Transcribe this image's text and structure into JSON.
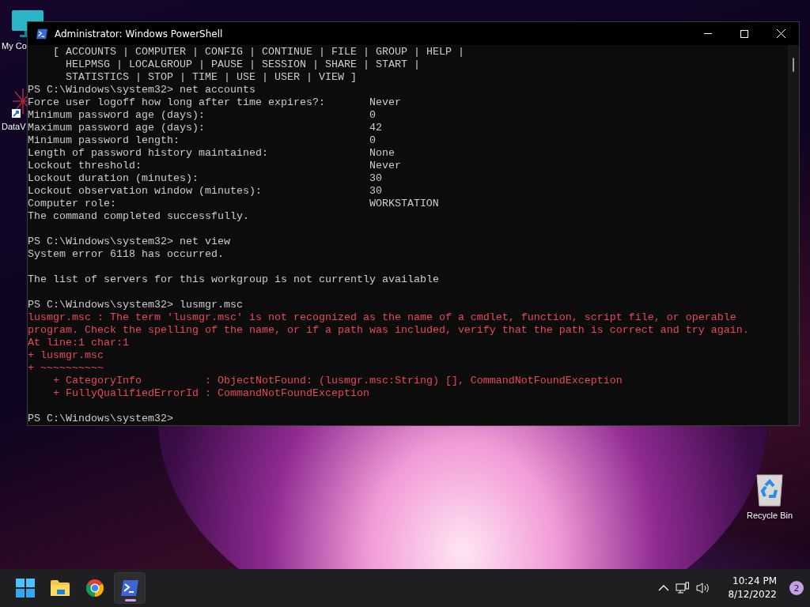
{
  "desktop_icons": [
    {
      "label": "My Co",
      "kind": "computer"
    },
    {
      "label": "DataV",
      "kind": "shortcut"
    },
    {
      "label": "Recycle Bin",
      "kind": "recycle"
    }
  ],
  "window": {
    "title": "Administrator: Windows PowerShell",
    "lines": [
      {
        "kind": "output",
        "text": "    [ ACCOUNTS | COMPUTER | CONFIG | CONTINUE | FILE | GROUP | HELP |"
      },
      {
        "kind": "output",
        "text": "      HELPMSG | LOCALGROUP | PAUSE | SESSION | SHARE | START |"
      },
      {
        "kind": "output",
        "text": "      STATISTICS | STOP | TIME | USE | USER | VIEW ]"
      },
      {
        "kind": "output",
        "text": "PS C:\\Windows\\system32> net accounts"
      },
      {
        "kind": "field",
        "label": "Force user logoff how long after time expires?:",
        "value": "Never"
      },
      {
        "kind": "field",
        "label": "Minimum password age (days):",
        "value": "0"
      },
      {
        "kind": "field",
        "label": "Maximum password age (days):",
        "value": "42"
      },
      {
        "kind": "field",
        "label": "Minimum password length:",
        "value": "0"
      },
      {
        "kind": "field",
        "label": "Length of password history maintained:",
        "value": "None"
      },
      {
        "kind": "field",
        "label": "Lockout threshold:",
        "value": "Never"
      },
      {
        "kind": "field",
        "label": "Lockout duration (minutes):",
        "value": "30"
      },
      {
        "kind": "field",
        "label": "Lockout observation window (minutes):",
        "value": "30"
      },
      {
        "kind": "field",
        "label": "Computer role:",
        "value": "WORKSTATION"
      },
      {
        "kind": "output",
        "text": "The command completed successfully."
      },
      {
        "kind": "blank"
      },
      {
        "kind": "output",
        "text": "PS C:\\Windows\\system32> net view"
      },
      {
        "kind": "output",
        "text": "System error 6118 has occurred."
      },
      {
        "kind": "blank"
      },
      {
        "kind": "output",
        "text": "The list of servers for this workgroup is not currently available"
      },
      {
        "kind": "blank"
      },
      {
        "kind": "output",
        "text": "PS C:\\Windows\\system32> lusmgr.msc"
      },
      {
        "kind": "error",
        "text": "lusmgr.msc : The term 'lusmgr.msc' is not recognized as the name of a cmdlet, function, script file, or operable"
      },
      {
        "kind": "error",
        "text": "program. Check the spelling of the name, or if a path was included, verify that the path is correct and try again."
      },
      {
        "kind": "error",
        "text": "At line:1 char:1"
      },
      {
        "kind": "error",
        "text": "+ lusmgr.msc"
      },
      {
        "kind": "error",
        "text": "+ ~~~~~~~~~~"
      },
      {
        "kind": "error",
        "text": "    + CategoryInfo          : ObjectNotFound: (lusmgr.msc:String) [], CommandNotFoundException"
      },
      {
        "kind": "error",
        "text": "    + FullyQualifiedErrorId : CommandNotFoundException"
      },
      {
        "kind": "blank"
      },
      {
        "kind": "output",
        "text": "PS C:\\Windows\\system32>"
      }
    ]
  },
  "taskbar": {
    "apps": [
      {
        "kind": "start",
        "active": false
      },
      {
        "kind": "folder",
        "active": false
      },
      {
        "kind": "browser",
        "active": false
      },
      {
        "kind": "terminal",
        "active": true
      }
    ],
    "time": "10:24 PM",
    "date": "8/12/2022",
    "notifications": "2"
  }
}
